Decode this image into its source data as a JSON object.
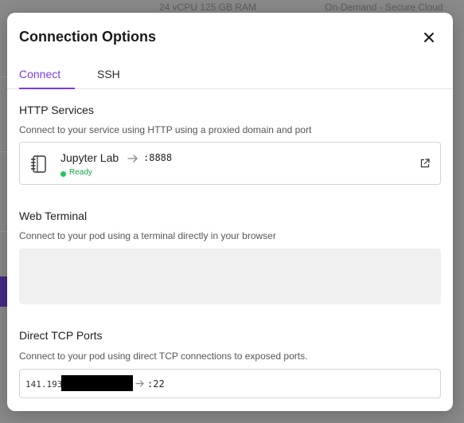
{
  "background": {
    "specs_text": "24 vCPU 125 GB RAM",
    "cloud_text": "On-Demand - Secure Cloud"
  },
  "modal": {
    "title": "Connection Options"
  },
  "tabs": [
    {
      "label": "Connect",
      "active": true
    },
    {
      "label": "SSH",
      "active": false
    }
  ],
  "http_services": {
    "title": "HTTP Services",
    "description": "Connect to your service using HTTP using a proxied domain and port",
    "service": {
      "name": "Jupyter Lab",
      "port": ":8888",
      "status": "Ready"
    }
  },
  "web_terminal": {
    "title": "Web Terminal",
    "description": "Connect to your pod using a terminal directly in your browser"
  },
  "tcp_ports": {
    "title": "Direct TCP Ports",
    "description": "Connect to your pod using direct TCP connections to exposed ports.",
    "ip_prefix": "141.193",
    "port": ":22"
  },
  "colors": {
    "accent": "#7c3aed",
    "status_ready": "#22c55e",
    "terminal_bg": "#f0f0f0"
  },
  "icons": {
    "close": "close-icon",
    "notebook": "notebook-icon",
    "arrow": "arrow-right-icon",
    "external_link": "external-link-icon"
  }
}
